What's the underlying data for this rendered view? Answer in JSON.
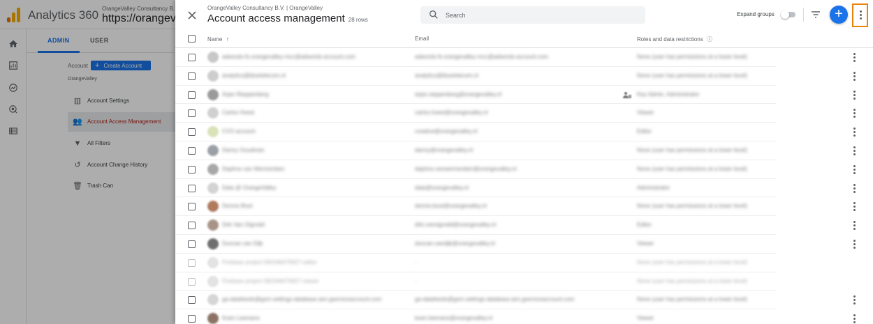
{
  "app": {
    "title": "Analytics 360",
    "account_line": "OrangeValley Consultancy B.",
    "property_line": "https://orangeva"
  },
  "colors": {
    "brand_orange": "#f9ab00",
    "accent_blue": "#1a73e8",
    "highlight_orange": "#e8830c"
  },
  "background": {
    "tabs": {
      "admin": "ADMIN",
      "user": "USER"
    },
    "account_label": "Account",
    "create_account_label": "Create Account",
    "account_value": "OrangeValley",
    "menu": [
      {
        "label": "Account Settings",
        "icon": "building-icon"
      },
      {
        "label": "Account Access Management",
        "icon": "people-icon"
      },
      {
        "label": "All Filters",
        "icon": "filter-icon"
      },
      {
        "label": "Account Change History",
        "icon": "history-icon"
      },
      {
        "label": "Trash Can",
        "icon": "trash-icon"
      }
    ]
  },
  "panel": {
    "breadcrumb": "OrangeValley Consultancy B.V. | OrangeValley",
    "title": "Account access management",
    "row_count": "28 rows",
    "search_placeholder": "Search",
    "expand_groups_label": "Expand groups",
    "expand_groups_on": false
  },
  "table": {
    "headers": {
      "name": "Name",
      "email": "Email",
      "roles": "Roles and data restrictions"
    },
    "rows": [
      {
        "name": "adwords-fs-orangevalley-mcc@adwords-account.com",
        "email": "adwords-fs-orangevalley-mcc@adwords-account.com",
        "role": "None (user has permissions at a lower level)"
      },
      {
        "name": "analytics@bluetelecom.nl",
        "email": "analytics@bluetelecom.nl",
        "role": "None (user has permissions at a lower level)"
      },
      {
        "name": "Arjan Rieppenberg",
        "email": "arjan.rieppenberg@orangevalley.nl",
        "role": "Key Admin, Administrator"
      },
      {
        "name": "Carlos Hoest",
        "email": "carlos.hoest@orangevalley.nl",
        "role": "Viewer"
      },
      {
        "name": "CVO account",
        "email": "creative@orangevalley.nl",
        "role": "Editor"
      },
      {
        "name": "Danny Goudman",
        "email": "danny@orangevalley.nl",
        "role": "None (user has permissions at a lower level)"
      },
      {
        "name": "Daphne van Wermerdam",
        "email": "daphne.vanwermerdam@orangevalley.nl",
        "role": "None (user has permissions at a lower level)"
      },
      {
        "name": "Data @ OrangeValley",
        "email": "data@orangevalley.nl",
        "role": "Administrator"
      },
      {
        "name": "Dennis Boot",
        "email": "dennis.boot@orangevalley.nl",
        "role": "None (user has permissions at a lower level)"
      },
      {
        "name": "Dirk Van Oigrodd",
        "email": "dirk.vanoigrodd@orangevalley.nl",
        "role": "Editor"
      },
      {
        "name": "Duncan van Dijk",
        "email": "duncan.vandijk@orangevalley.nl",
        "role": "Viewer"
      },
      {
        "name": "Firebase project 582348475827-editor",
        "email": "-",
        "role": "None (user has permissions at a lower level)"
      },
      {
        "name": "Firebase project 582348475827-viewer",
        "email": "-",
        "role": "None (user has permissions at a lower level)"
      },
      {
        "name": "ga-datafeeds@gsm-settings-database.iam.gserviceaccount.com",
        "email": "ga-datafeeds@gsm-settings-database.iam.gserviceaccount.com",
        "role": "None (user has permissions at a lower level)"
      },
      {
        "name": "Koen Leemans",
        "email": "koen.leemans@orangevalley.nl",
        "role": "Viewer"
      }
    ]
  }
}
